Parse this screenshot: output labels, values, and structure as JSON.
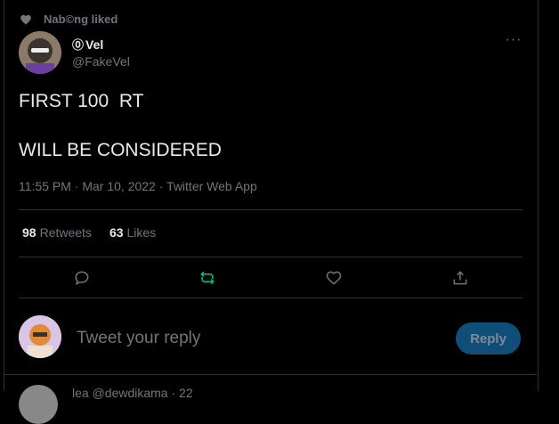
{
  "social_context": {
    "text": "Nab©ng liked"
  },
  "tweet": {
    "author_mark": "⓪",
    "author_name": "Vel",
    "handle": "@FakeVel",
    "line1": "FIRST 100  RT",
    "line2": "WILL BE CONSIDERED",
    "time": "11:55 PM",
    "date": "Mar 10, 2022",
    "source": "Twitter Web App"
  },
  "stats": {
    "retweets_count": "98",
    "retweets_label": "Retweets",
    "likes_count": "63",
    "likes_label": "Likes"
  },
  "actions": [
    "reply-icon",
    "retweet-icon",
    "like-icon",
    "share-icon"
  ],
  "colors": {
    "retweet_active": "#00ba7c",
    "reply_button": "#0f4e78"
  },
  "reply": {
    "placeholder": "Tweet your reply",
    "button_label": "Reply"
  },
  "next_tweet": {
    "preview_text": "lea @dewdikama  · 22"
  }
}
